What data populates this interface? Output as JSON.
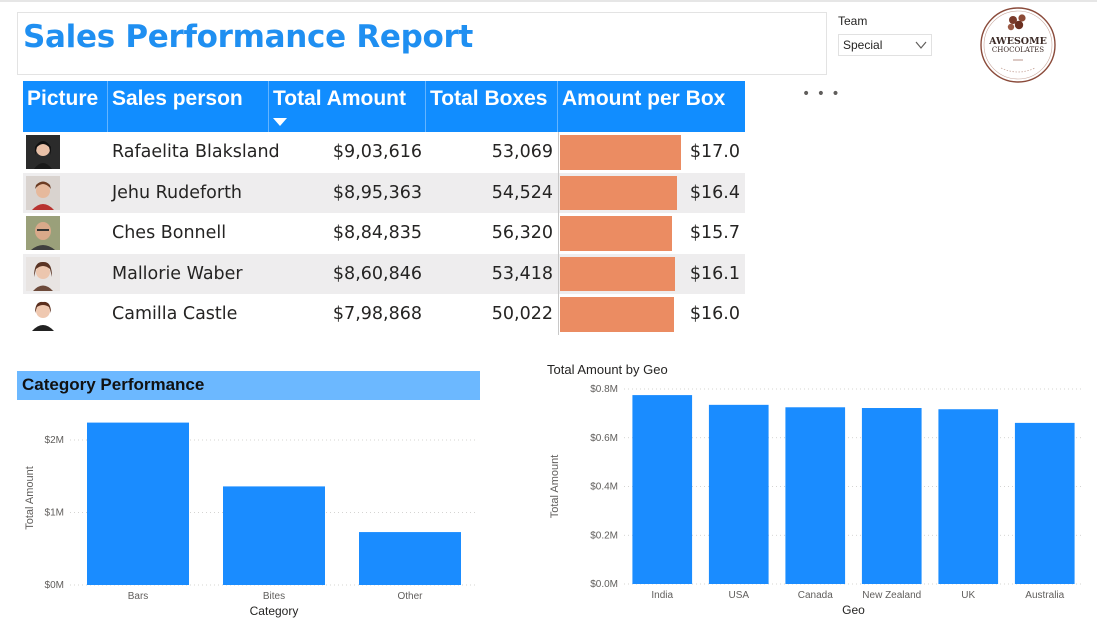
{
  "report": {
    "title": "Sales Performance Report"
  },
  "slicer": {
    "label": "Team",
    "selected": "Special"
  },
  "logo": {
    "line1": "AWESOME",
    "line2": "CHOCOLATES"
  },
  "table": {
    "columns": [
      "Picture",
      "Sales person",
      "Total Amount",
      "Total Boxes",
      "Amount per Box"
    ],
    "sorted_column": "Total Amount",
    "rows": [
      {
        "name": "Rafaelita Blaksland",
        "amount": "$9,03,616",
        "boxes": "53,069",
        "per_box": "$17.0",
        "per_box_value": 17.0
      },
      {
        "name": "Jehu Rudeforth",
        "amount": "$8,95,363",
        "boxes": "54,524",
        "per_box": "$16.4",
        "per_box_value": 16.4
      },
      {
        "name": "Ches Bonnell",
        "amount": "$8,84,835",
        "boxes": "56,320",
        "per_box": "$15.7",
        "per_box_value": 15.7
      },
      {
        "name": "Mallorie Waber",
        "amount": "$8,60,846",
        "boxes": "53,418",
        "per_box": "$16.1",
        "per_box_value": 16.1
      },
      {
        "name": "Camilla Castle",
        "amount": "$7,98,868",
        "boxes": "50,022",
        "per_box": "$16.0",
        "per_box_value": 16.0
      }
    ],
    "bar_color": "#eb8c62",
    "header_color": "#118dff"
  },
  "colors": {
    "accent": "#1f8ff1",
    "bar": "#1a8cff",
    "section_header": "#6cb8ff"
  },
  "category_panel": {
    "title": "Category Performance"
  },
  "chart_data": [
    {
      "type": "bar",
      "title": "",
      "xlabel": "Category",
      "ylabel": "Total Amount",
      "categories": [
        "Bars",
        "Bites",
        "Other"
      ],
      "values": [
        2240000,
        1360000,
        730000
      ],
      "yticks": [
        "$0M",
        "$1M",
        "$2M"
      ],
      "ytick_values": [
        0,
        1000000,
        2000000
      ],
      "ylim": [
        0,
        2400000
      ],
      "grid": true
    },
    {
      "type": "bar",
      "title": "Total Amount by Geo",
      "xlabel": "Geo",
      "ylabel": "Total Amount",
      "categories": [
        "India",
        "USA",
        "Canada",
        "New Zealand",
        "UK",
        "Australia"
      ],
      "values": [
        775000,
        735000,
        725000,
        722000,
        717000,
        661000
      ],
      "yticks": [
        "$0.0M",
        "$0.2M",
        "$0.4M",
        "$0.6M",
        "$0.8M"
      ],
      "ytick_values": [
        0,
        200000,
        400000,
        600000,
        800000
      ],
      "ylim": [
        0,
        800000
      ],
      "grid": true
    }
  ]
}
